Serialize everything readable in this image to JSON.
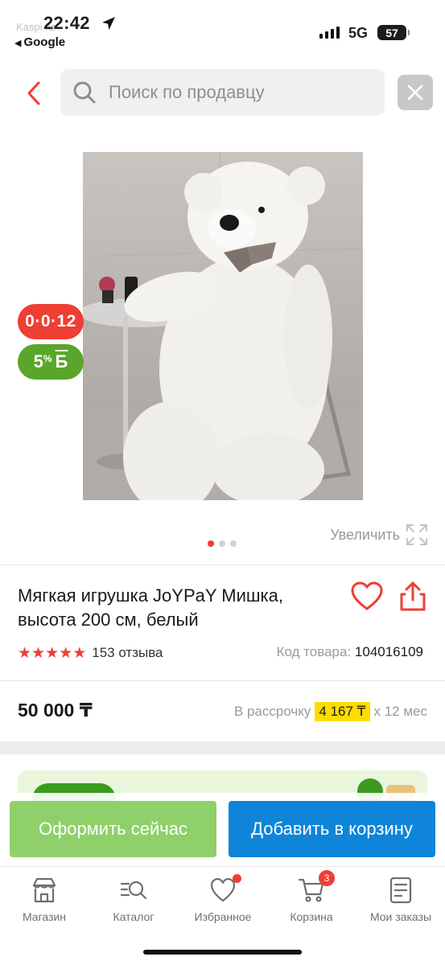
{
  "status_bar": {
    "time": "22:42",
    "back_app": "Google",
    "site_badge": "Kaspi.kz",
    "network": "5G",
    "battery": "57"
  },
  "search": {
    "placeholder": "Поиск по продавцу"
  },
  "badges": {
    "installment": "0·0·12",
    "bonus_value": "5",
    "bonus_percent": "%",
    "bonus_letter": "Б"
  },
  "gallery": {
    "zoom_label": "Увеличить",
    "active_index": 1,
    "total": 3
  },
  "product": {
    "title": "Мягкая игрушка JoYPaY Мишка, высота 200 см, белый",
    "rating": 5,
    "reviews": "153 отзыва",
    "code_label": "Код товара:",
    "code": "104016109",
    "price": "50 000 ₸",
    "installment_prefix": "В рассрочку",
    "installment_amount": "4 167 ₸",
    "installment_suffix": "x 12 мес"
  },
  "actions": {
    "buy_now": "Оформить сейчас",
    "add_to_cart": "Добавить в корзину"
  },
  "tabbar": {
    "items": [
      {
        "label": "Магазин",
        "icon": "store-icon"
      },
      {
        "label": "Каталог",
        "icon": "catalog-search-icon"
      },
      {
        "label": "Избранное",
        "icon": "heart-icon"
      },
      {
        "label": "Корзина",
        "icon": "cart-icon"
      },
      {
        "label": "Мои заказы",
        "icon": "orders-icon"
      }
    ],
    "cart_count": "3"
  },
  "colors": {
    "brand_red": "#ef3e33",
    "bonus_green": "#5aa62c",
    "buy_green": "#8fd06a",
    "cart_blue": "#0e85d8",
    "installment_highlight": "#ffdc00"
  }
}
